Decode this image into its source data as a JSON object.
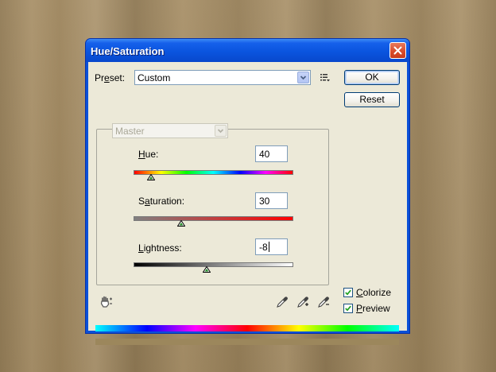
{
  "dialog": {
    "title": "Hue/Saturation",
    "preset_label_pre": "Pr",
    "preset_label_key": "e",
    "preset_label_post": "set:",
    "preset_value": "Custom",
    "ok_label": "OK",
    "reset_label": "Reset",
    "channel_value": "Master",
    "hue": {
      "label_key": "H",
      "label_rest": "ue:",
      "value": "40",
      "fraction": 0.11
    },
    "saturation": {
      "label_pre": "S",
      "label_key": "a",
      "label_rest": "turation:",
      "value": "30",
      "fraction": 0.3
    },
    "lightness": {
      "label_key": "L",
      "label_rest": "ightness:",
      "value": "-8",
      "fraction": 0.46
    },
    "colorize": {
      "label_key": "C",
      "label_rest": "olorize",
      "checked": true
    },
    "preview": {
      "label_key": "P",
      "label_rest": "review",
      "checked": true
    },
    "colors": {
      "title_blue": "#0a55df",
      "frame_blue": "#0a50d8",
      "face": "#ece9d8",
      "result_swatch": "#9c875c",
      "close_red": "#d8492a"
    },
    "icons": [
      "close-icon",
      "dropdown-arrow-icon",
      "preset-options-icon",
      "hand-adjust-icon",
      "eyedropper-icon",
      "eyedropper-plus-icon",
      "eyedropper-minus-icon",
      "check-icon",
      "slider-thumb-icon"
    ]
  }
}
